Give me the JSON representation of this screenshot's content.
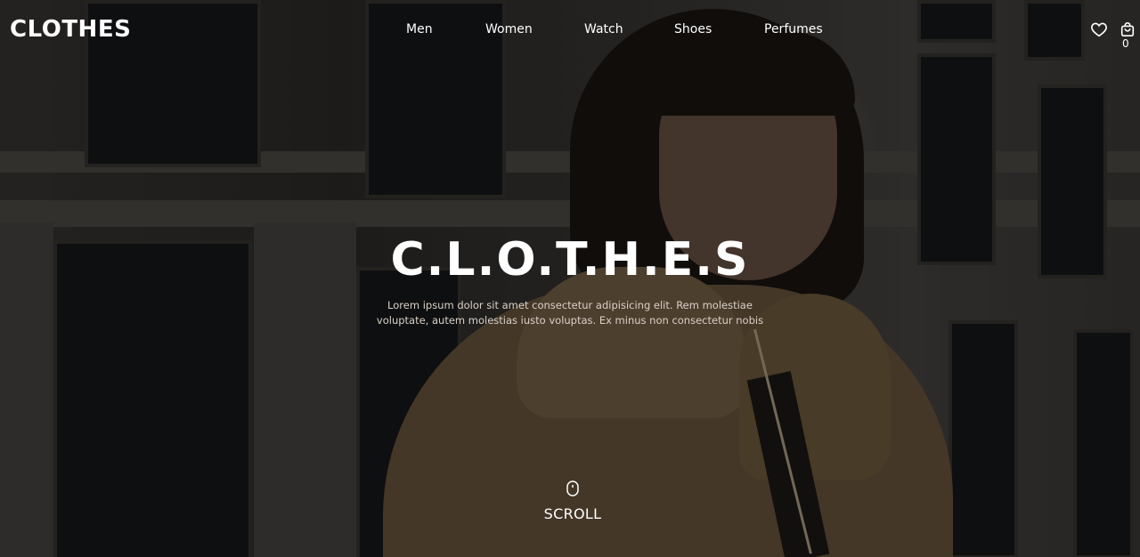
{
  "brand": {
    "logo": "CLOTHES"
  },
  "nav": {
    "items": [
      {
        "label": "Men"
      },
      {
        "label": "Women"
      },
      {
        "label": "Watch"
      },
      {
        "label": "Shoes"
      },
      {
        "label": "Perfumes"
      }
    ]
  },
  "header_icons": {
    "wishlist": "heart-icon",
    "cart": "shopping-bag-icon",
    "cart_count": "0"
  },
  "hero": {
    "title": "C.L.O.T.H.E.S",
    "description": "Lorem ipsum dolor sit amet consectetur adipisicing elit. Rem molestiae voluptate, autem molestias iusto voluptas. Ex minus non consectetur nobis",
    "scroll_label": "SCROLL",
    "scroll_icon": "mouse-icon"
  },
  "colors": {
    "text": "#ffffff",
    "overlay": "rgba(0,0,0,0.38)"
  }
}
